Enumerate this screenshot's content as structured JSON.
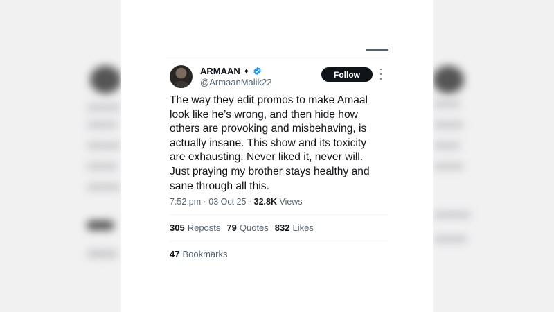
{
  "author": {
    "name": "ARMAAN",
    "handle": "@ArmaanMalik22",
    "verified_color": "#1d9bf0"
  },
  "follow_label": "Follow",
  "tweet": {
    "lines": [
      "The way they edit promos to make Amaal",
      "look like he’s wrong, and then hide how",
      "others are provoking and misbehaving, is",
      "actually insane. This show and its toxicity",
      "are exhausting. Never liked it, never will.",
      "Just praying my brother stays healthy and",
      "sane through all this."
    ]
  },
  "meta": {
    "time": "7:52 pm",
    "date": "03 Oct 25",
    "views_count": "32.8K",
    "views_label": "Views"
  },
  "stats": {
    "reposts_count": "305",
    "reposts_label": "Reposts",
    "quotes_count": "79",
    "quotes_label": "Quotes",
    "likes_count": "832",
    "likes_label": "Likes",
    "bookmarks_count": "47",
    "bookmarks_label": "Bookmarks"
  },
  "icons": {
    "name_badge": "sparkle-icon",
    "verified": "verified-badge-icon",
    "more": "more-options-icon"
  }
}
